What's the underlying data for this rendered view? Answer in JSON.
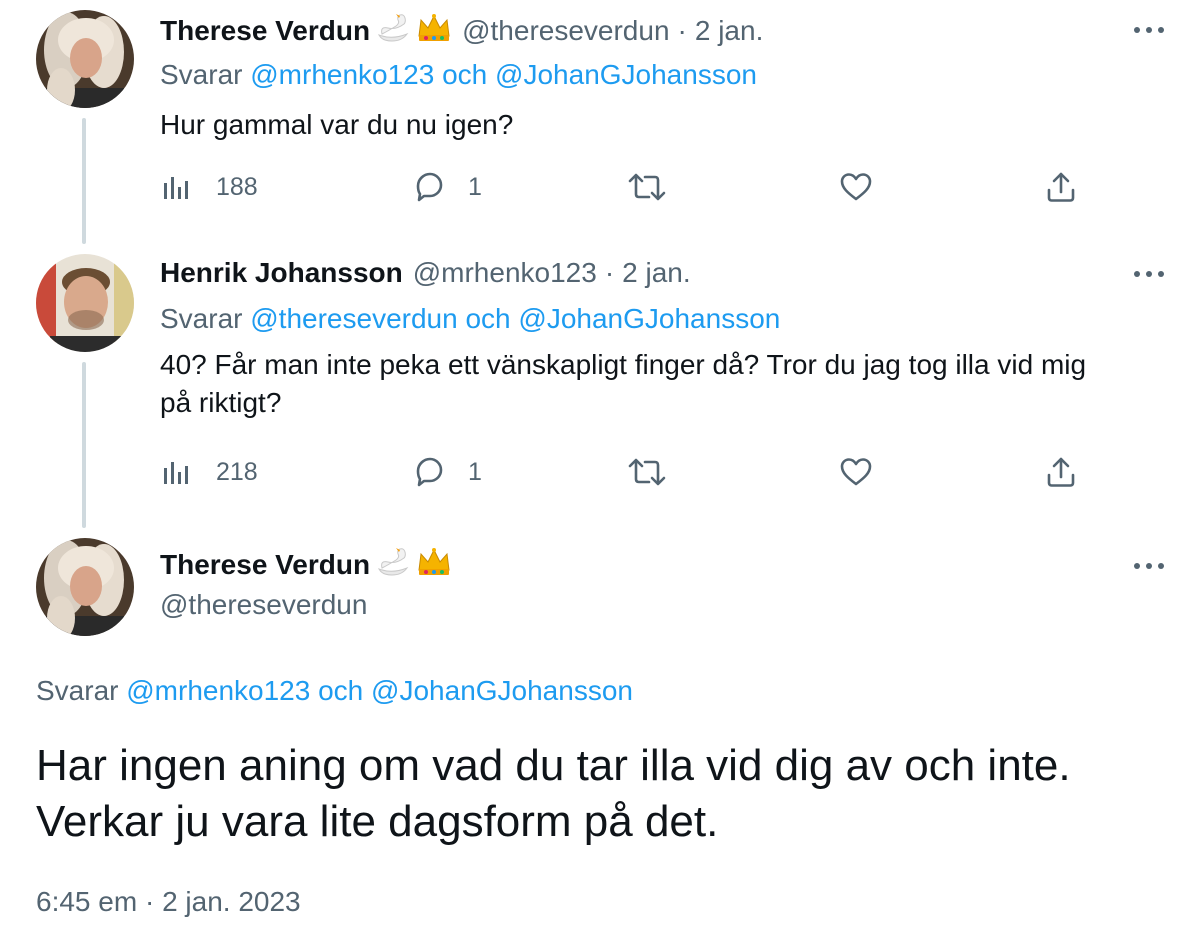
{
  "tweets": [
    {
      "author_name": "Therese Verdun",
      "handle": "@thereseverdun",
      "separator": "·",
      "date": "2 jan.",
      "reply_prefix": "Svarar",
      "reply_user1": "@mrhenko123",
      "reply_and": "och",
      "reply_user2": "@JohanGJohansson",
      "text": "Hur gammal var du nu igen?",
      "views": "188",
      "replies": "1",
      "icons": [
        "swan-emoji",
        "crown-emoji"
      ]
    },
    {
      "author_name": "Henrik Johansson",
      "handle": "@mrhenko123",
      "separator": "·",
      "date": "2 jan.",
      "reply_prefix": "Svarar",
      "reply_user1": "@thereseverdun",
      "reply_and": "och",
      "reply_user2": "@JohanGJohansson",
      "text_line1": "40? Får man inte peka ett vänskapligt finger då? Tror du jag tog illa vid mig",
      "text_line2": "på riktigt?",
      "views": "218",
      "replies": "1"
    }
  ],
  "main_tweet": {
    "author_name": "Therese Verdun",
    "handle": "@thereseverdun",
    "reply_prefix": "Svarar",
    "reply_user1": "@mrhenko123",
    "reply_and": "och",
    "reply_user2": "@JohanGJohansson",
    "text_line1": "Har ingen aning om vad du tar illa vid dig av och inte.",
    "text_line2": "Verkar ju vara lite dagsform på det.",
    "time": "6:45 em",
    "separator": "·",
    "date": "2 jan. 2023",
    "icons": [
      "swan-emoji",
      "crown-emoji"
    ]
  },
  "colors": {
    "text": "#0f1419",
    "secondary": "#536471",
    "link": "#1d9bf0",
    "thread_line": "#cfd9de"
  }
}
